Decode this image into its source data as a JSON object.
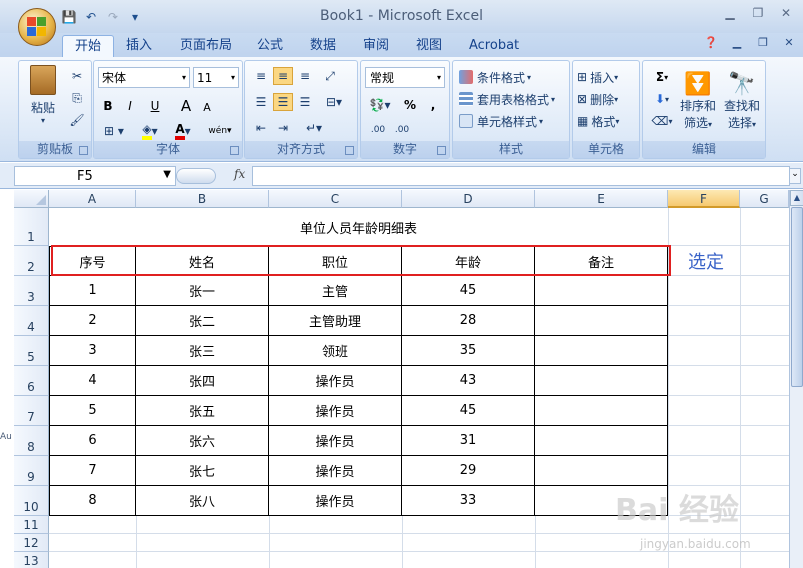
{
  "window": {
    "title": "Book1 - Microsoft Excel"
  },
  "qat": {
    "icons": [
      "save-icon",
      "undo-icon",
      "redo-icon",
      "customize-icon"
    ]
  },
  "tabs": [
    {
      "label": "开始",
      "active": true
    },
    {
      "label": "插入"
    },
    {
      "label": "页面布局"
    },
    {
      "label": "公式"
    },
    {
      "label": "数据"
    },
    {
      "label": "审阅"
    },
    {
      "label": "视图"
    },
    {
      "label": "Acrobat"
    }
  ],
  "ribbon": {
    "clipboard": {
      "label": "剪贴板",
      "paste": "粘贴"
    },
    "font": {
      "label": "字体",
      "name": "宋体",
      "size": "11",
      "bold": "B",
      "italic": "I",
      "underline": "U",
      "grow": "A",
      "shrink": "A",
      "phonetic": "wén"
    },
    "alignment": {
      "label": "对齐方式"
    },
    "number": {
      "label": "数字",
      "format": "常规",
      "percent": "%",
      "comma": ",",
      "dec_inc": ".00",
      "dec_dec": ".00"
    },
    "styles": {
      "label": "样式",
      "conditional": "条件格式",
      "table": "套用表格格式",
      "cell": "单元格样式"
    },
    "cells": {
      "label": "单元格",
      "insert": "插入",
      "delete": "删除",
      "format": "格式"
    },
    "editing": {
      "label": "编辑",
      "sum": "Σ",
      "sort": "排序和\n筛选",
      "sort_line1": "排序和",
      "sort_line2": "筛选",
      "find_line1": "查找和",
      "find_line2": "选择"
    }
  },
  "formula_bar": {
    "name_box": "F5",
    "fx": "fx",
    "value": ""
  },
  "columns": [
    "A",
    "B",
    "C",
    "D",
    "E",
    "F",
    "G"
  ],
  "rows": [
    "1",
    "2",
    "3",
    "4",
    "5",
    "6",
    "7",
    "8",
    "9",
    "10",
    "11",
    "12",
    "13"
  ],
  "sheet": {
    "title": "单位人员年龄明细表",
    "headers": [
      "序号",
      "姓名",
      "职位",
      "年龄",
      "备注"
    ],
    "data": [
      [
        "1",
        "张一",
        "主管",
        "45",
        ""
      ],
      [
        "2",
        "张二",
        "主管助理",
        "28",
        ""
      ],
      [
        "3",
        "张三",
        "领班",
        "35",
        ""
      ],
      [
        "4",
        "张四",
        "操作员",
        "43",
        ""
      ],
      [
        "5",
        "张五",
        "操作员",
        "45",
        ""
      ],
      [
        "6",
        "张六",
        "操作员",
        "31",
        ""
      ],
      [
        "7",
        "张七",
        "操作员",
        "29",
        ""
      ],
      [
        "8",
        "张八",
        "操作员",
        "33",
        ""
      ]
    ]
  },
  "annotation": {
    "text": "选定",
    "color": "#3a63c8"
  },
  "selection_color": "#e02020",
  "watermark": {
    "text": "Bai 经验",
    "sub": "jingyan.baidu.com"
  },
  "side_artifact": "Au"
}
